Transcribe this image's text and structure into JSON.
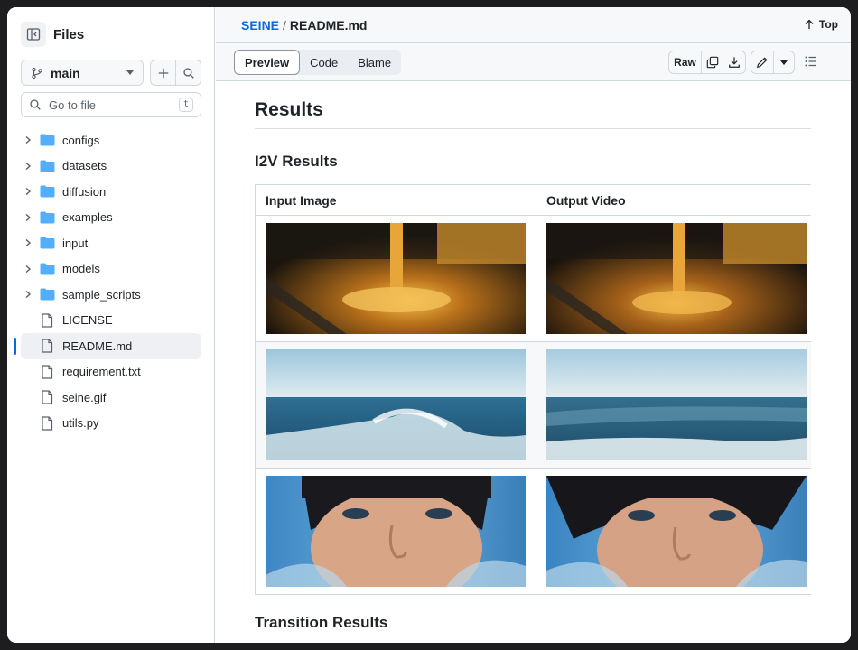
{
  "sidebar": {
    "title": "Files",
    "branch": "main",
    "goto_placeholder": "Go to file",
    "goto_shortcut": "t",
    "tree": [
      {
        "type": "folder",
        "name": "configs"
      },
      {
        "type": "folder",
        "name": "datasets"
      },
      {
        "type": "folder",
        "name": "diffusion"
      },
      {
        "type": "folder",
        "name": "examples"
      },
      {
        "type": "folder",
        "name": "input"
      },
      {
        "type": "folder",
        "name": "models"
      },
      {
        "type": "folder",
        "name": "sample_scripts"
      },
      {
        "type": "file",
        "name": "LICENSE"
      },
      {
        "type": "file",
        "name": "README.md",
        "active": true
      },
      {
        "type": "file",
        "name": "requirement.txt"
      },
      {
        "type": "file",
        "name": "seine.gif"
      },
      {
        "type": "file",
        "name": "utils.py"
      }
    ]
  },
  "header": {
    "repo": "SEINE",
    "separator": "/",
    "file": "README.md",
    "top_label": "Top"
  },
  "toolbar": {
    "tabs": [
      "Preview",
      "Code",
      "Blame"
    ],
    "active_tab": "Preview",
    "raw_label": "Raw"
  },
  "content": {
    "h1": "Results",
    "h2_i2v": "I2V Results",
    "table_headers": [
      "Input Image",
      "Output Video"
    ],
    "rows": [
      [
        "golden-liquid-pour-image",
        "golden-liquid-pour-video"
      ],
      [
        "ocean-wave-image",
        "ocean-wave-video"
      ],
      [
        "woman-face-water-image",
        "woman-face-water-video"
      ]
    ],
    "h2_transition": "Transition Results"
  },
  "colors": {
    "accent": "#0969da",
    "folder": "#54aeff",
    "border": "#d0d7de"
  }
}
